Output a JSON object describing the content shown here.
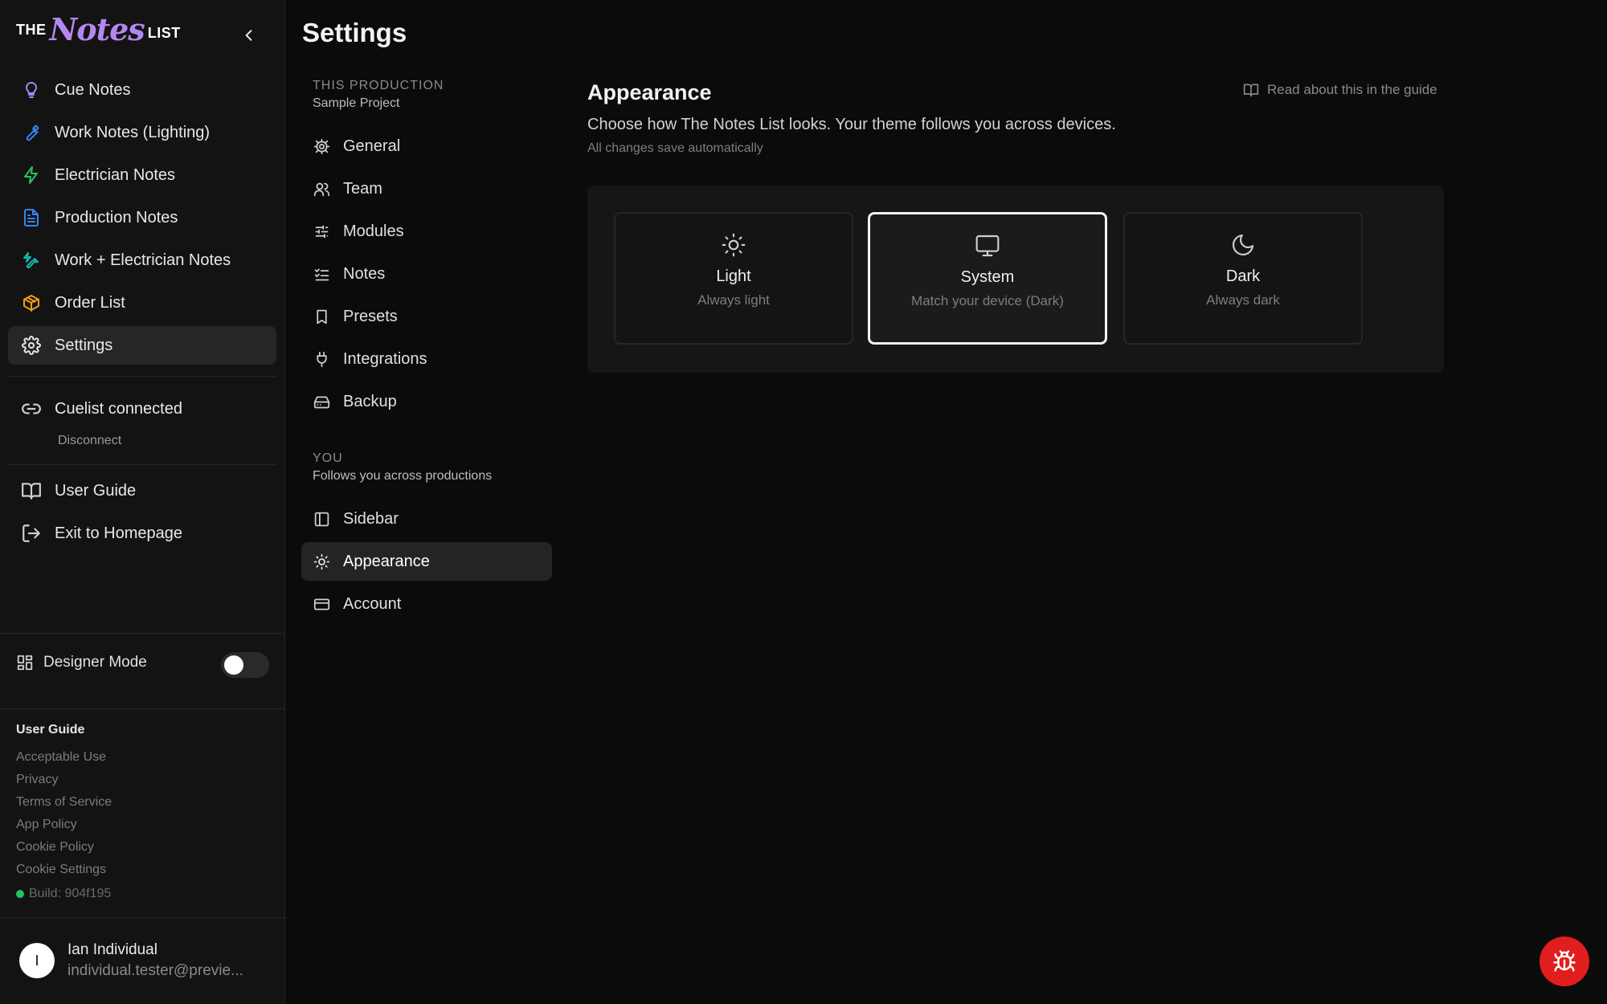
{
  "brand": {
    "the": "THE",
    "notes": "Notes",
    "list": "LIST"
  },
  "sidebar": {
    "items": [
      {
        "label": "Cue Notes",
        "icon": "lightbulb-icon",
        "color": "#a78bfa"
      },
      {
        "label": "Work Notes (Lighting)",
        "icon": "wrench-icon",
        "color": "#3b82f6"
      },
      {
        "label": "Electrician Notes",
        "icon": "lightning-bolt-icon",
        "color": "#22c55e"
      },
      {
        "label": "Production Notes",
        "icon": "document-icon",
        "color": "#3b82f6"
      },
      {
        "label": "Work + Electrician Notes",
        "icon": "wrench-bolt-icon",
        "color": "#14b8a6"
      },
      {
        "label": "Order List",
        "icon": "package-icon",
        "color": "#f59e0b"
      },
      {
        "label": "Settings",
        "icon": "gear-icon",
        "color": "#e6e6e6"
      }
    ],
    "cuelist_status": "Cuelist connected",
    "disconnect_label": "Disconnect",
    "user_guide_label": "User Guide",
    "exit_label": "Exit to Homepage",
    "designer_mode_label": "Designer Mode",
    "designer_mode_on": false,
    "footer_heading": "User Guide",
    "footer_links": [
      "Acceptable Use",
      "Privacy",
      "Terms of Service",
      "App Policy",
      "Cookie Policy",
      "Cookie Settings"
    ],
    "build": "Build: 904f195",
    "user": {
      "initial": "I",
      "name": "Ian Individual",
      "email": "individual.tester@previe..."
    }
  },
  "page": {
    "title": "Settings"
  },
  "settings_nav": {
    "production_label": "THIS PRODUCTION",
    "production_name": "Sample Project",
    "production_items": [
      {
        "label": "General",
        "icon": "gear-icon"
      },
      {
        "label": "Team",
        "icon": "users-icon"
      },
      {
        "label": "Modules",
        "icon": "sliders-icon"
      },
      {
        "label": "Notes",
        "icon": "checklist-icon"
      },
      {
        "label": "Presets",
        "icon": "bookmark-icon"
      },
      {
        "label": "Integrations",
        "icon": "plug-icon"
      },
      {
        "label": "Backup",
        "icon": "hard-drive-icon"
      }
    ],
    "you_label": "YOU",
    "you_sub": "Follows you across productions",
    "you_items": [
      {
        "label": "Sidebar",
        "icon": "sidebar-panel-icon"
      },
      {
        "label": "Appearance",
        "icon": "sun-icon",
        "active": true
      },
      {
        "label": "Account",
        "icon": "credit-card-icon"
      }
    ]
  },
  "appearance": {
    "title": "Appearance",
    "guide_link": "Read about this in the guide",
    "description": "Choose how The Notes List looks. Your theme follows you across devices.",
    "autosave": "All changes save automatically",
    "themes": [
      {
        "name": "Light",
        "sub": "Always light",
        "icon": "sun-icon"
      },
      {
        "name": "System",
        "sub": "Match your device (Dark)",
        "icon": "monitor-icon",
        "selected": true
      },
      {
        "name": "Dark",
        "sub": "Always dark",
        "icon": "moon-icon"
      }
    ]
  },
  "colors": {
    "accent": "#b487f0",
    "background": "#0b0b0b",
    "bug_button": "#e11d1d",
    "online": "#22c55e"
  }
}
